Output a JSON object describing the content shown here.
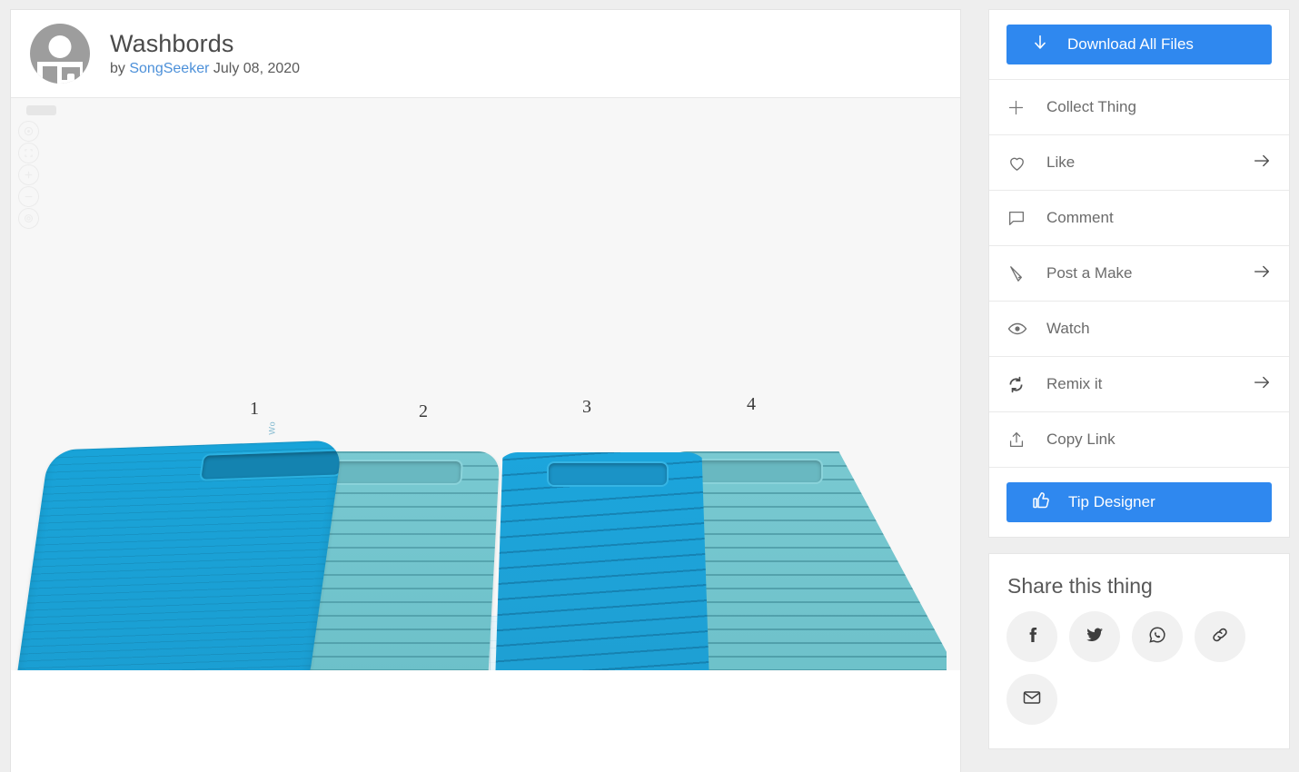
{
  "thing": {
    "title": "Washbords",
    "by_prefix": "by",
    "author": "SongSeeker",
    "date": "July 08, 2020",
    "avatar_icon": "user-avatar-icon"
  },
  "viewer": {
    "model_labels": [
      "1",
      "2",
      "3",
      "4"
    ],
    "plane_mark": "Wo",
    "controls": [
      {
        "name": "view-home-control",
        "icon": "target-icon"
      },
      {
        "name": "view-fit-control",
        "icon": "fit-screen-icon"
      },
      {
        "name": "zoom-in-control",
        "icon": "plus-icon"
      },
      {
        "name": "zoom-out-control",
        "icon": "minus-icon"
      },
      {
        "name": "view-settings-control",
        "icon": "gear-icon"
      }
    ],
    "background_color": "#f7f7f7",
    "board_colors": [
      "#19a3d8",
      "#79c9d1",
      "#1ca5dc",
      "#79c9d1"
    ]
  },
  "sidebar": {
    "download": {
      "label": "Download All Files",
      "icon": "download-arrow-icon"
    },
    "actions": [
      {
        "label": "Collect Thing",
        "icon": "plus-icon",
        "arrow": false
      },
      {
        "label": "Like",
        "icon": "heart-icon",
        "arrow": true
      },
      {
        "label": "Comment",
        "icon": "comment-bubble-icon",
        "arrow": false
      },
      {
        "label": "Post a Make",
        "icon": "pencil-icon",
        "arrow": true
      },
      {
        "label": "Watch",
        "icon": "eye-icon",
        "arrow": false
      },
      {
        "label": "Remix it",
        "icon": "remix-refresh-icon",
        "arrow": true
      },
      {
        "label": "Copy Link",
        "icon": "share-upload-icon",
        "arrow": false
      }
    ],
    "tip": {
      "label": "Tip Designer",
      "icon": "thumbs-up-icon"
    }
  },
  "share": {
    "title": "Share this thing",
    "buttons": [
      {
        "name": "share-facebook-button",
        "icon": "facebook-icon"
      },
      {
        "name": "share-twitter-button",
        "icon": "twitter-icon"
      },
      {
        "name": "share-whatsapp-button",
        "icon": "whatsapp-icon"
      },
      {
        "name": "share-link-button",
        "icon": "link-chain-icon"
      },
      {
        "name": "share-email-button",
        "icon": "envelope-icon"
      }
    ]
  },
  "colors": {
    "accent_blue": "#2f88ef",
    "page_bg": "#eeeeee",
    "card_bg": "#ffffff",
    "text_gray": "#6b6b6b",
    "link_blue": "#4c90d9"
  }
}
